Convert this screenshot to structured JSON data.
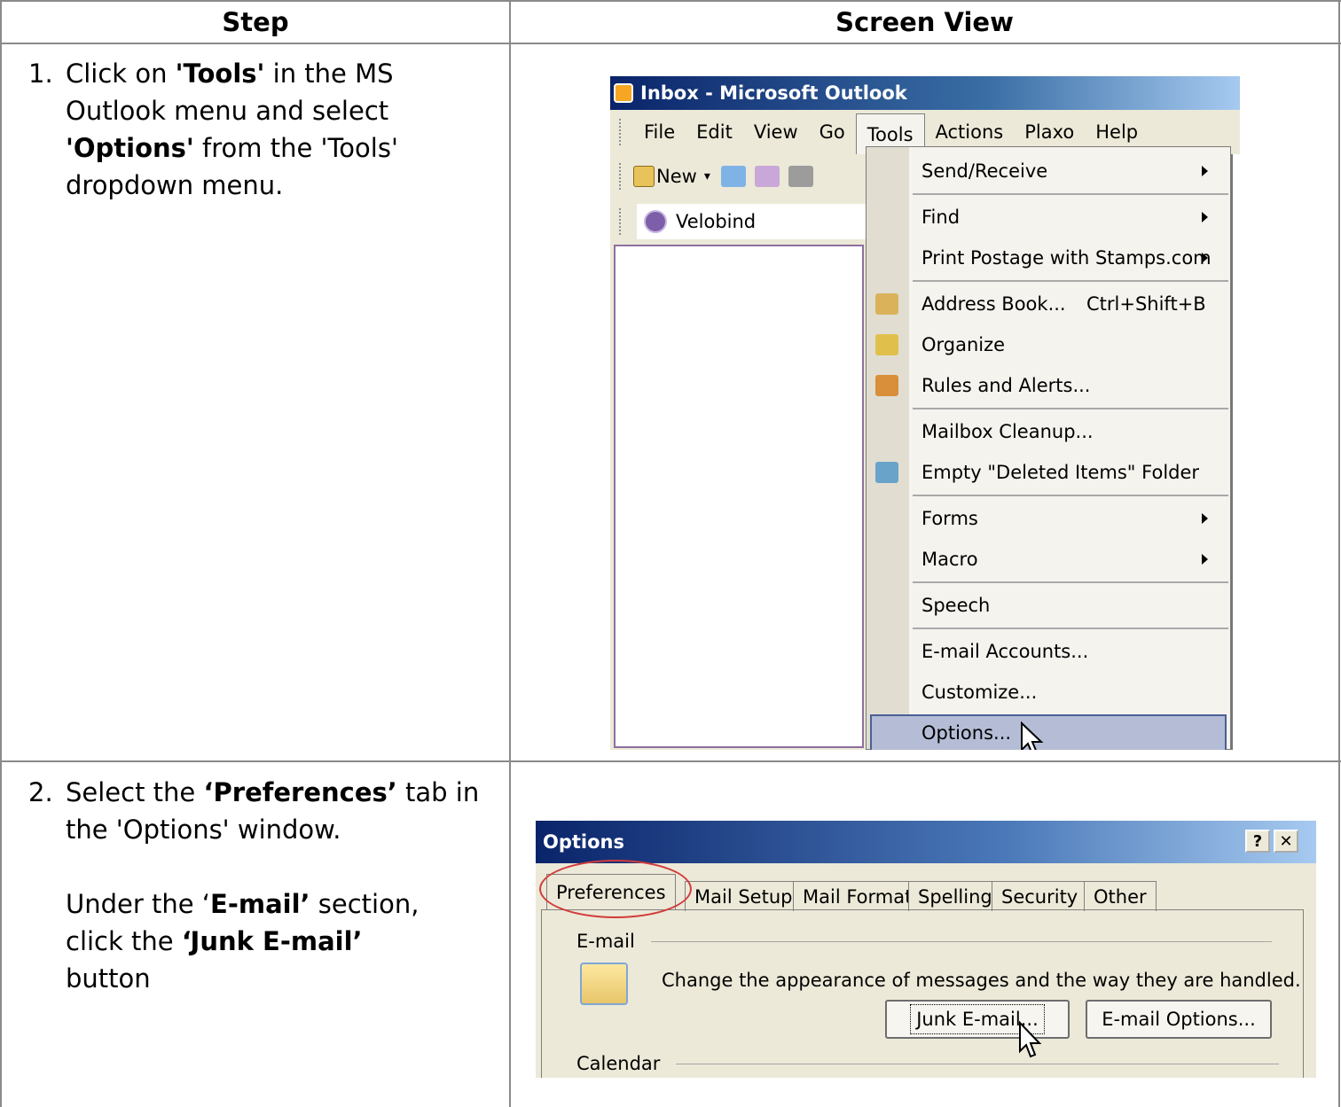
{
  "table": {
    "headers": {
      "step": "Step",
      "screen_view": "Screen View"
    }
  },
  "steps": [
    {
      "number": "1.",
      "parts": [
        {
          "text": "Click on ",
          "bold": false
        },
        {
          "text": "'Tools'",
          "bold": true
        },
        {
          "text": " in the MS Outlook menu and select ",
          "bold": false
        },
        {
          "text": "'Options'",
          "bold": true
        },
        {
          "text": " from the 'Tools' dropdown menu.",
          "bold": false
        }
      ]
    },
    {
      "number": "2.",
      "parts": [
        {
          "text": "Select the ",
          "bold": false
        },
        {
          "text": "‘Preferences’",
          "bold": true
        },
        {
          "text": " tab in the 'Options' window.",
          "bold": false
        }
      ],
      "parts2": [
        {
          "text": "Under the ‘",
          "bold": false
        },
        {
          "text": "E-mail’",
          "bold": true
        },
        {
          "text": " section, click the ",
          "bold": false
        },
        {
          "text": "‘Junk E-mail’",
          "bold": true
        },
        {
          "text": " button",
          "bold": false
        }
      ]
    }
  ],
  "outlook": {
    "title": "Inbox - Microsoft Outlook",
    "menubar": [
      "File",
      "Edit",
      "View",
      "Go",
      "Tools",
      "Actions",
      "Plaxo",
      "Help"
    ],
    "active_menu": "Tools",
    "toolbar_new": "New",
    "address_label": "Velobind",
    "tools_menu": [
      {
        "label": "Send/Receive",
        "submenu": true,
        "icon": ""
      },
      {
        "sep": true
      },
      {
        "label": "Find",
        "submenu": true,
        "icon": ""
      },
      {
        "label": "Print Postage with Stamps.com",
        "submenu": true,
        "icon": ""
      },
      {
        "sep": true
      },
      {
        "label": "Address Book...",
        "shortcut": "Ctrl+Shift+B",
        "icon": "address-book-icon"
      },
      {
        "label": "Organize",
        "icon": "organize-icon"
      },
      {
        "label": "Rules and Alerts...",
        "icon": "rules-icon"
      },
      {
        "sep": true
      },
      {
        "label": "Mailbox Cleanup...",
        "icon": ""
      },
      {
        "label": "Empty \"Deleted Items\" Folder",
        "icon": "empty-trash-icon"
      },
      {
        "sep": true
      },
      {
        "label": "Forms",
        "submenu": true,
        "icon": ""
      },
      {
        "label": "Macro",
        "submenu": true,
        "icon": ""
      },
      {
        "sep": true
      },
      {
        "label": "Speech",
        "icon": ""
      },
      {
        "sep": true
      },
      {
        "label": "E-mail Accounts...",
        "icon": ""
      },
      {
        "label": "Customize...",
        "icon": ""
      },
      {
        "label": "Options...",
        "icon": "",
        "highlighted": true
      }
    ],
    "colors": {
      "title_bar": "#0a246a",
      "highlight": "#b5bdd6",
      "nav_border": "#8e6f9f"
    }
  },
  "options_dialog": {
    "title": "Options",
    "help_button": "?",
    "close_button": "✕",
    "tabs": [
      "Preferences",
      "Mail Setup",
      "Mail Format",
      "Spelling",
      "Security",
      "Other"
    ],
    "selected_tab": "Preferences",
    "section_email": "E-mail",
    "email_description": "Change the appearance of messages and the way they are handled.",
    "junk_button": "Junk E-mail...",
    "email_options_button": "E-mail Options...",
    "section_calendar": "Calendar",
    "annotation_color": "#d13b3b"
  }
}
